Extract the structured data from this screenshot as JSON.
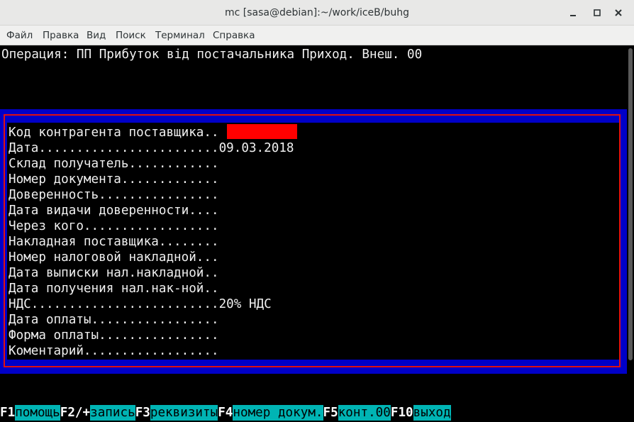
{
  "window": {
    "title": "mc [sasa@debian]:~/work/iceB/buhg"
  },
  "menu": [
    "Файл",
    "Правка",
    "Вид",
    "Поиск",
    "Терминал",
    "Справка"
  ],
  "terminal": {
    "operation_line": "Операция: ПП Прибуток від постачальника Приход. Внеш. 00",
    "fields": [
      "Код контрагента поставщика..",
      "Дата........................09.03.2018",
      "Склад получатель............",
      "Номер документа.............",
      "Доверенность................",
      "Дата видачи доверенности....",
      "Через кого..................",
      "Накладная поставщика........",
      "Номер налоговой накладной...",
      "Дата выписки нал.накладной..",
      "Дата получения нал.нак-ной..",
      "НДС.........................20% НДС",
      "Дата оплаты.................",
      "Форма оплаты................",
      "Коментарий.................."
    ],
    "fkeys": [
      {
        "key": "F1",
        "label": "помощь"
      },
      {
        "key": "F2/+",
        "label": "запись"
      },
      {
        "key": "F3",
        "label": "реквизиты"
      },
      {
        "key": "F4",
        "label": "номер докум."
      },
      {
        "key": "F5",
        "label": "конт.00"
      },
      {
        "key": "F10",
        "label": "выход"
      }
    ]
  }
}
